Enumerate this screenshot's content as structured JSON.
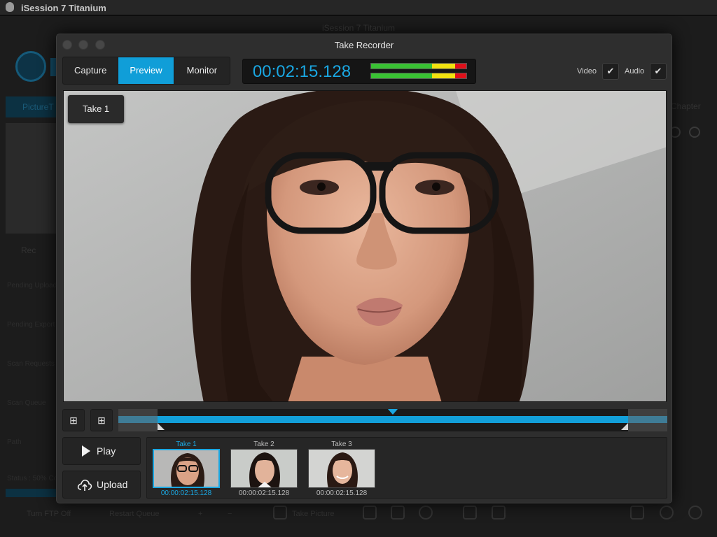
{
  "app": {
    "menu_name": "iSession 7 Titanium",
    "window_title": "iSession 7 Titanium"
  },
  "background": {
    "side_tab": "PictureT",
    "side_rec": "Rec",
    "side_labels": [
      "Pending Uploads",
      "Pending Export",
      "Scan Requests",
      "Scan Queue",
      "Path",
      "Status : 50% Comp"
    ],
    "chapter": "Chapter",
    "bottom": {
      "ftp": "Turn FTP Off",
      "restart": "Restart Queue",
      "take_picture": "Take Picture"
    }
  },
  "dialog": {
    "title": "Take Recorder",
    "tabs": [
      {
        "label": "Capture",
        "active": false
      },
      {
        "label": "Preview",
        "active": true
      },
      {
        "label": "Monitor",
        "active": false
      }
    ],
    "timecode": "00:02:15.128",
    "meters": [
      {
        "channel": "left",
        "green": 0.64,
        "yellow": 0.24,
        "red": 0.12
      },
      {
        "channel": "right",
        "green": 0.64,
        "yellow": 0.24,
        "red": 0.12
      }
    ],
    "video": {
      "label": "Video",
      "checked": true
    },
    "audio": {
      "label": "Audio",
      "checked": true
    },
    "take_badge": "Take 1",
    "timeline": {
      "playhead_fraction": 0.5,
      "trim_in_fraction": 0.072,
      "trim_out_fraction": 0.928
    },
    "play_label": "Play",
    "upload_label": "Upload",
    "takes": [
      {
        "label": "Take 1",
        "time": "00:00:02:15.128",
        "active": true
      },
      {
        "label": "Take 2",
        "time": "00:00:02:15.128",
        "active": false
      },
      {
        "label": "Take 3",
        "time": "00:00:02:15.128",
        "active": false
      }
    ]
  },
  "colors": {
    "accent": "#109ed8",
    "meter_green": "#39c233",
    "meter_yellow": "#f2e30f",
    "meter_red": "#e0101a"
  }
}
